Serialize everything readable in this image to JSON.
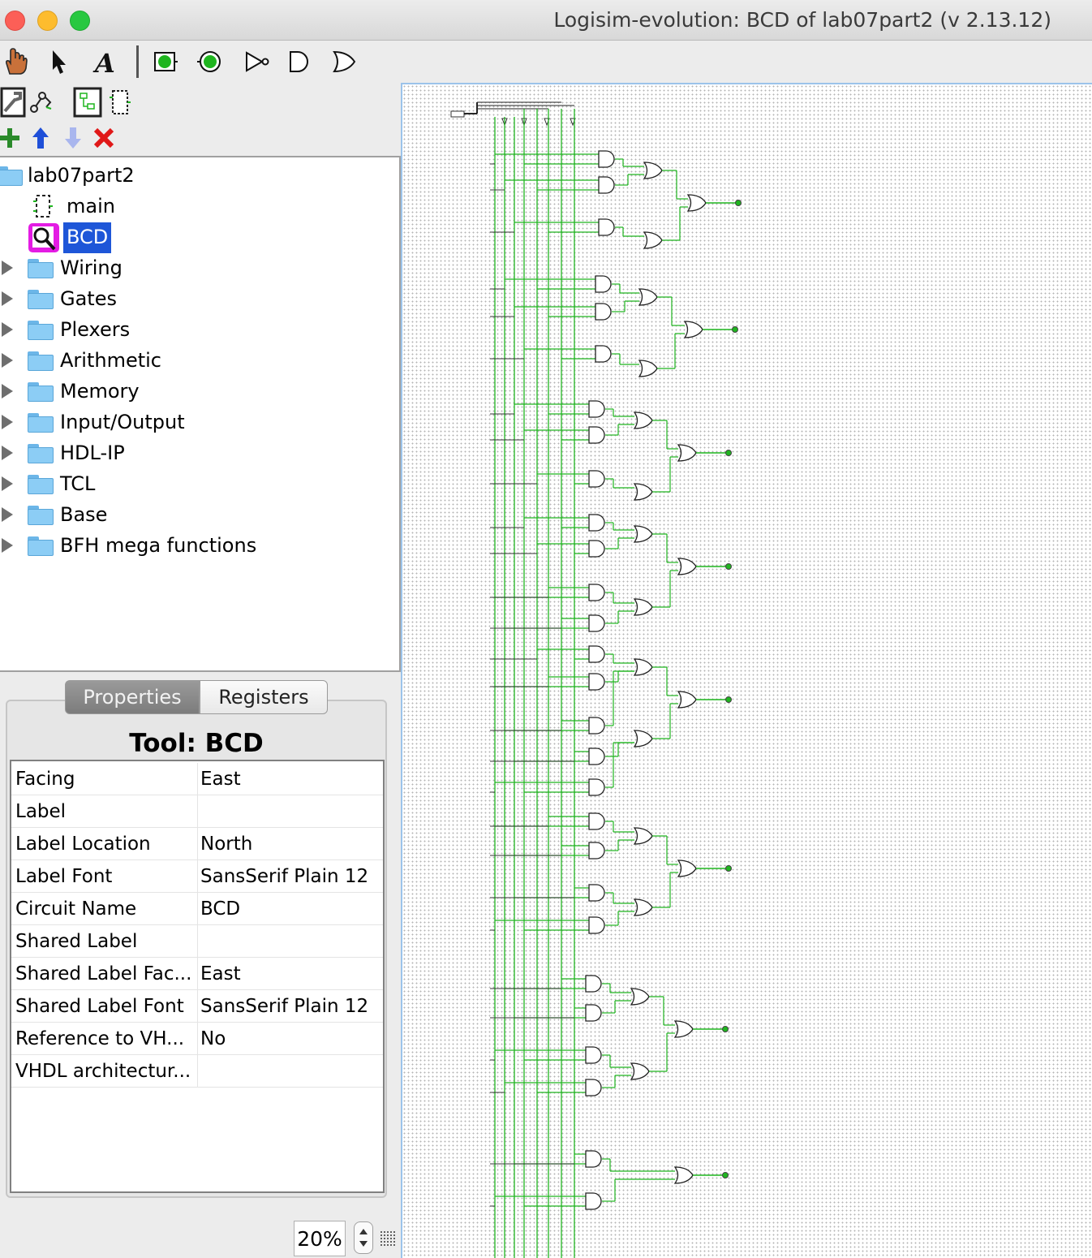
{
  "window": {
    "title": "Logisim-evolution: BCD of lab07part2 (v 2.13.12)"
  },
  "toolbar": {
    "row1": [
      "hand-poke-icon",
      "select-arrow-icon",
      "text-tool-icon",
      "input-pin-icon",
      "output-pin-icon",
      "not-gate-icon",
      "and-gate-icon",
      "or-gate-icon"
    ],
    "row2": [
      "wrench-icon",
      "simulate-icon",
      "layout-icon",
      "appearance-icon"
    ],
    "row3": [
      "add-circuit-icon",
      "move-up-icon",
      "move-down-icon",
      "delete-icon"
    ]
  },
  "explorer": {
    "project": "lab07part2",
    "circuits": [
      {
        "label": "main"
      },
      {
        "label": "BCD"
      }
    ],
    "libraries": [
      "Wiring",
      "Gates",
      "Plexers",
      "Arithmetic",
      "Memory",
      "Input/Output",
      "HDL-IP",
      "TCL",
      "Base",
      "BFH mega functions"
    ]
  },
  "tabs": {
    "properties": "Properties",
    "registers": "Registers"
  },
  "tool_title": "Tool: BCD",
  "properties": [
    {
      "key": "Facing",
      "value": "East"
    },
    {
      "key": "Label",
      "value": ""
    },
    {
      "key": "Label Location",
      "value": "North"
    },
    {
      "key": "Label Font",
      "value": "SansSerif Plain 12"
    },
    {
      "key": "Circuit Name",
      "value": "BCD"
    },
    {
      "key": "Shared Label",
      "value": ""
    },
    {
      "key": "Shared Label Fac...",
      "value": "East"
    },
    {
      "key": "Shared Label Font",
      "value": "SansSerif Plain 12"
    },
    {
      "key": "Reference to VH...",
      "value": "No"
    },
    {
      "key": "VHDL architectur...",
      "value": ""
    }
  ],
  "zoom": "20%",
  "colors": {
    "wire": "#1fb51f",
    "selection": "#1e56d8",
    "highlight": "#e41ce4"
  }
}
